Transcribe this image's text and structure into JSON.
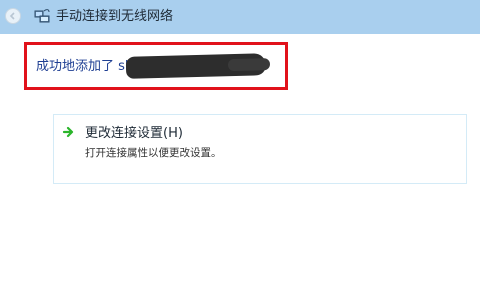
{
  "window": {
    "title": "手动连接到无线网络"
  },
  "result": {
    "message": "成功地添加了 shuilianshuizhishu"
  },
  "options": [
    {
      "title": "更改连接设置(H)",
      "description": "打开连接属性以便更改设置。",
      "icon": "green-arrow-icon"
    }
  ],
  "colors": {
    "titlebar": "#a9cfee",
    "highlight_border": "#e1121b",
    "message_text": "#1f3f93",
    "arrow": "#2bb52b"
  }
}
